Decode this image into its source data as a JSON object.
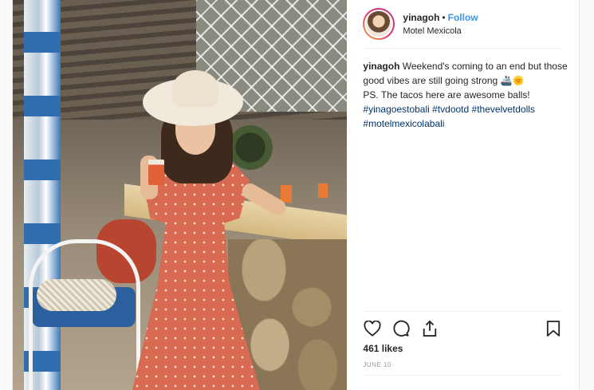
{
  "post": {
    "username": "yinagoh",
    "separator": "•",
    "follow_label": "Follow",
    "location": "Motel Mexicola",
    "caption": {
      "username": "yinagoh",
      "text_line1": "Weekend's coming to an end but those good vibes are still going strong 🚢🌞",
      "text_line2": "PS. The tacos here are awesome balls!",
      "hashtags": [
        "#yinagoestobali",
        "#tvdootd",
        "#thevelvetdolls",
        "#motelmexicolabali"
      ]
    },
    "actions": {
      "like_icon": "heart-icon",
      "comment_icon": "comment-icon",
      "share_icon": "share-icon",
      "save_icon": "bookmark-icon"
    },
    "likes": "461 likes",
    "date": "JUNE 10"
  },
  "colors": {
    "link": "#3897f0",
    "hashtag": "#003569",
    "dress": "#d96a52"
  }
}
